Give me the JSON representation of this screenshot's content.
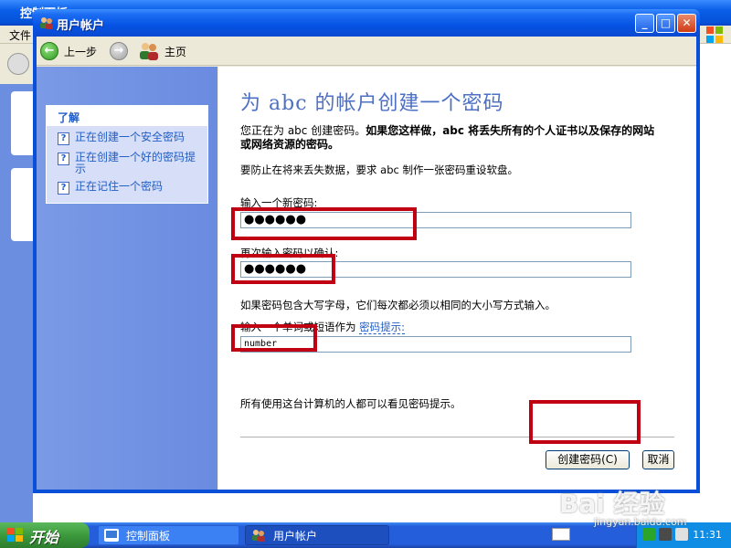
{
  "background_window": {
    "title": "控制面板",
    "menu_file": "文件"
  },
  "window": {
    "title": "用户帐户",
    "minimize_icon": "minimize-icon",
    "maximize_icon": "maximize-icon",
    "close_icon": "close-icon"
  },
  "navbar": {
    "back_label": "上一步",
    "home_label": "主页"
  },
  "left_pane": {
    "header": "了解",
    "links": [
      "正在创建一个安全密码",
      "正在创建一个好的密码提示",
      "正在记住一个密码"
    ]
  },
  "content": {
    "heading": "为 abc 的帐户创建一个密码",
    "intro_prefix": "您正在为 abc 创建密码。",
    "intro_bold": "如果您这样做，abc 将丢失所有的个人证书以及保存的网站或网络资源的密码。",
    "reset_note": "要防止在将来丢失数据，要求 abc 制作一张密码重设软盘。",
    "new_password_label": "输入一个新密码:",
    "new_password_value": "●●●●●●",
    "confirm_label": "再次输入密码以确认:",
    "confirm_value": "●●●●●●",
    "case_note": "如果密码包含大写字母，它们每次都必须以相同的大小写方式输入。",
    "hint_label": "输入一个单词或短语作为",
    "hint_link": "密码提示:",
    "hint_value": "number",
    "hint_visible_note": "所有使用这台计算机的人都可以看见密码提示。",
    "create_button": "创建密码(C)",
    "cancel_button": "取消"
  },
  "taskbar": {
    "start_label": "开始",
    "tasks": [
      "控制面板",
      "用户帐户"
    ],
    "clock": "11:31"
  },
  "watermark": {
    "text": "Bai 经验",
    "url": "jingyan.baidu.com"
  },
  "colors": {
    "highlight": "#c00012",
    "xp_blue": "#0a4fd8",
    "link_blue": "#215dc6"
  }
}
